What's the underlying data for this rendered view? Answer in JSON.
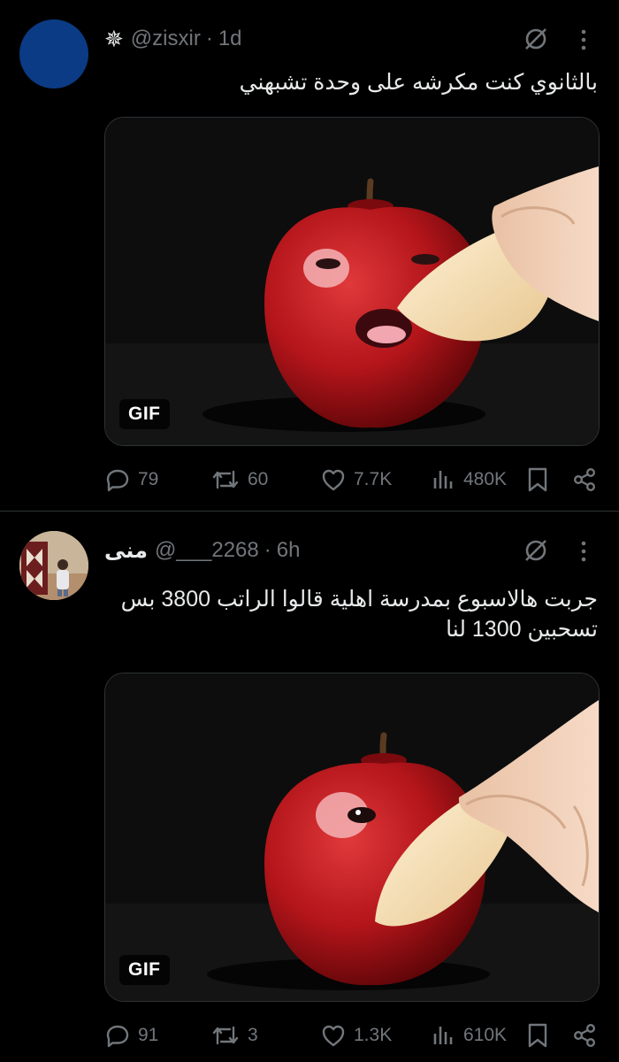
{
  "tweets": [
    {
      "display_name": "",
      "badge": "✵",
      "handle": "@zisxir",
      "time": "1d",
      "text": "بالثانوي كنت مكرشه على وحدة تشبهني",
      "media_badge": "GIF",
      "stats": {
        "replies": "79",
        "retweets": "60",
        "likes": "7.7K",
        "views": "480K"
      }
    },
    {
      "display_name": "منى",
      "badge": "",
      "handle": "@___2268",
      "time": "6h",
      "text": "جربت هالاسبوع بمدرسة اهلية قالوا الراتب 3800 بس تسحبين 1300 لنا",
      "media_badge": "GIF",
      "stats": {
        "replies": "91",
        "retweets": "3",
        "likes": "1.3K",
        "views": "610K"
      }
    }
  ],
  "header_separator": "·",
  "colors": {
    "background": "#000000",
    "text_primary": "#e7e9ea",
    "text_secondary": "#71767b",
    "divider": "#2f3336",
    "avatar_1": "#0b3b84"
  }
}
